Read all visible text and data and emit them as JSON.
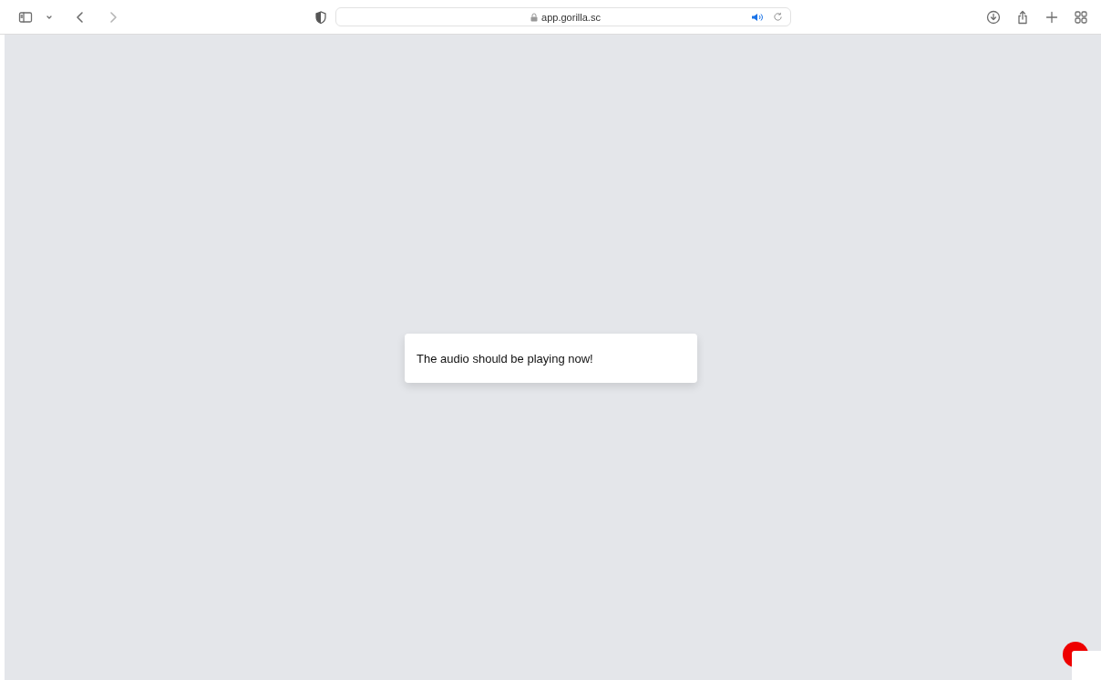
{
  "browser": {
    "url": "app.gorilla.sc",
    "audio_playing": true
  },
  "message": {
    "text": "The audio should be playing now!"
  }
}
